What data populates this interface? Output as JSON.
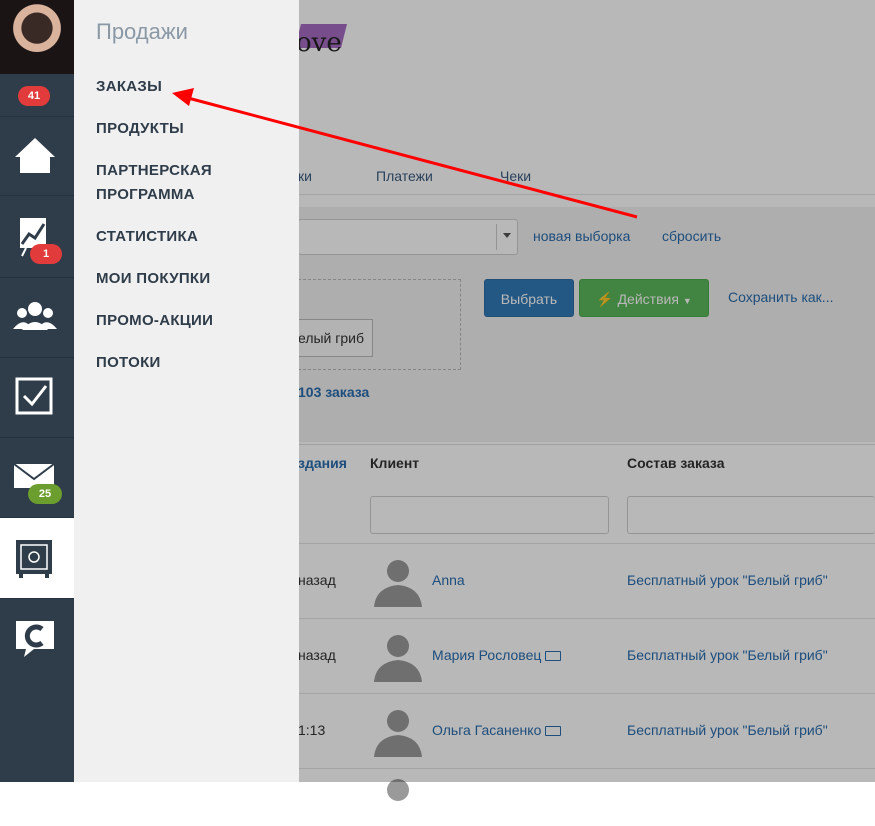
{
  "sidebar": {
    "avatar_badge": "41",
    "items": [
      {
        "name": "home",
        "icon": "home-icon"
      },
      {
        "name": "analytics",
        "icon": "chart-icon",
        "badge": "1"
      },
      {
        "name": "users",
        "icon": "users-icon"
      },
      {
        "name": "tasks",
        "icon": "checkbox-icon"
      },
      {
        "name": "messages",
        "icon": "mail-icon",
        "badge": "25"
      },
      {
        "name": "sales",
        "icon": "safe-icon",
        "active": true
      },
      {
        "name": "chat",
        "icon": "chat-bubble-icon"
      }
    ],
    "badge_colors": {
      "red": "#e23b3b",
      "green": "#6b9e2e"
    }
  },
  "menu": {
    "title": "Продажи",
    "items": [
      {
        "label": "ЗАКАЗЫ"
      },
      {
        "label": "ПРОДУКТЫ"
      },
      {
        "label": "ПАРТНЕРСКАЯ ПРОГРАММА"
      },
      {
        "label": "СТАТИСТИКА"
      },
      {
        "label": "МОИ ПОКУПКИ"
      },
      {
        "label": "ПРОМО-АКЦИИ"
      },
      {
        "label": "ПОТОКИ"
      }
    ]
  },
  "logo": {
    "text": "ove"
  },
  "tabs": [
    {
      "label": "ки"
    },
    {
      "label": "Платежи"
    },
    {
      "label": "Чеки"
    }
  ],
  "filters": {
    "new_selection": "новая выборка",
    "reset": "сбросить",
    "chip": "елый гриб"
  },
  "actions": {
    "select_button": "Выбрать",
    "actions_button": "Действия",
    "save_as": "Сохранить как..."
  },
  "orders_count": "103 заказа",
  "table": {
    "columns": [
      "здания",
      "Клиент",
      "Состав заказа"
    ],
    "rows": [
      {
        "date": "назад",
        "client": "Anna",
        "money": false,
        "order": "Бесплатный урок \"Белый гриб\""
      },
      {
        "date": "назад",
        "client": "Мария Рословец",
        "money": true,
        "order": "Бесплатный урок \"Белый гриб\""
      },
      {
        "date": "1:13",
        "client": "Ольга Гасаненко",
        "money": true,
        "order": "Бесплатный урок \"Белый гриб\""
      }
    ]
  },
  "annotation_arrow": {
    "color": "#ff0000"
  }
}
